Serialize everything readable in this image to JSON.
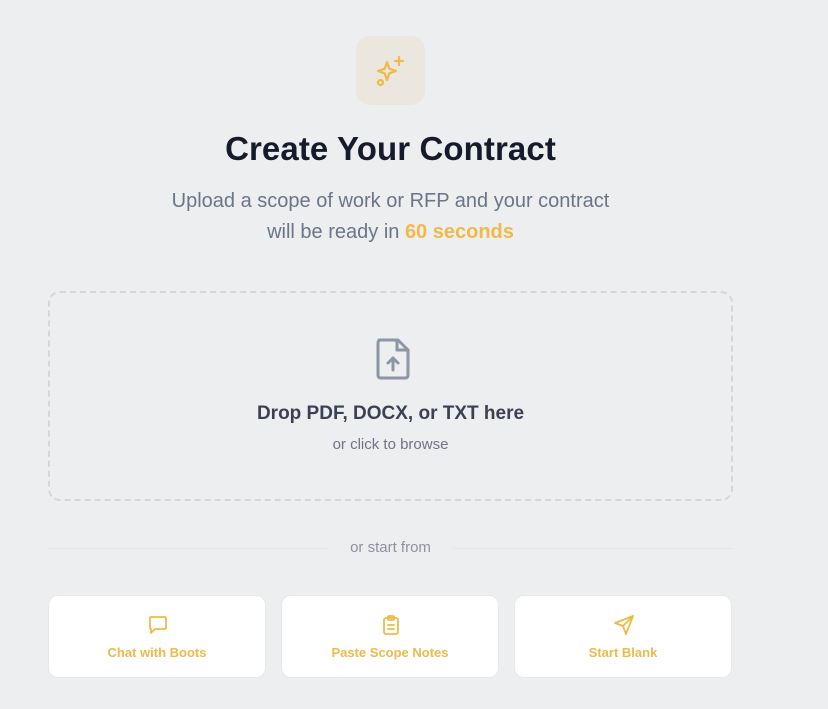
{
  "hero": {
    "icon": "sparkles-icon",
    "title": "Create Your Contract",
    "subtitle_line1": "Upload a scope of work or RFP and your contract",
    "subtitle_line2_prefix": "will be ready in ",
    "subtitle_highlight": "60 seconds"
  },
  "dropzone": {
    "icon": "file-upload-icon",
    "title": "Drop PDF, DOCX, or TXT here",
    "subtitle": "or click to browse"
  },
  "divider": {
    "label": "or start from"
  },
  "options": [
    {
      "label": "Chat with Boots",
      "icon": "chat-bubble-icon"
    },
    {
      "label": "Paste Scope Notes",
      "icon": "clipboard-icon"
    },
    {
      "label": "Start Blank",
      "icon": "paper-plane-icon"
    }
  ],
  "colors": {
    "accent": "#f0b94a",
    "title": "#151b2b",
    "muted": "#6b7587",
    "background": "#eceef0"
  }
}
